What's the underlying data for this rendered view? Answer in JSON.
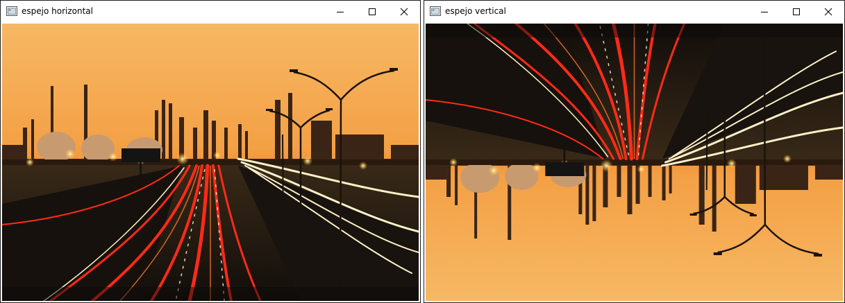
{
  "windows": [
    {
      "title": "espejo horizontal",
      "controls": [
        "minimize-icon",
        "maximize-icon",
        "close-icon"
      ],
      "image": "night highway with red and white light trails leading to illuminated refinery at sunset"
    },
    {
      "title": "espejo vertical",
      "controls": [
        "minimize-icon",
        "maximize-icon",
        "close-icon"
      ],
      "image": "same highway refinery photo flipped upside down"
    }
  ],
  "colors": {
    "sky_top": "#f7b45a",
    "sky_bottom": "#f08a2a",
    "trail_red": "#ff2a18",
    "trail_white": "#fff2c8",
    "road": "#1c1712"
  }
}
